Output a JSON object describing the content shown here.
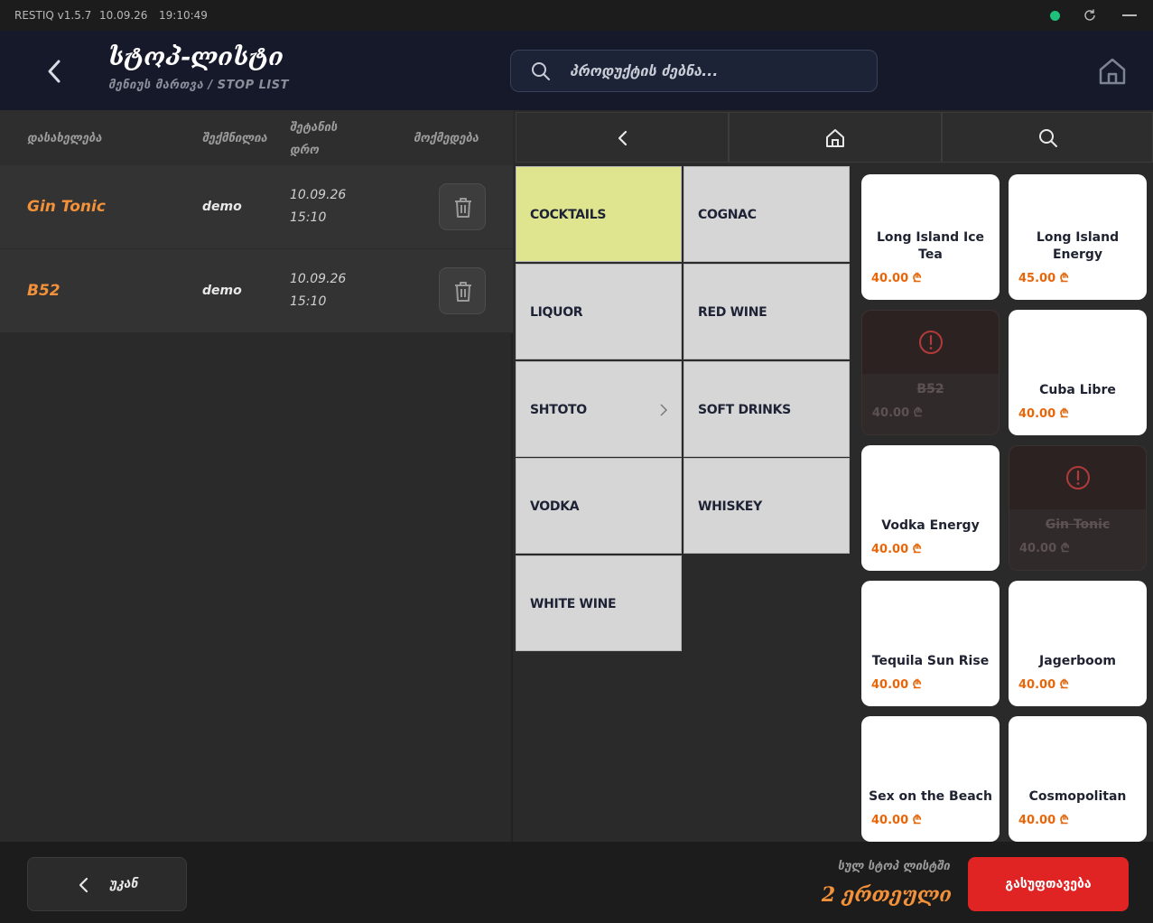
{
  "sysbar": {
    "app": "RESTIQ v1.5.7",
    "date": "10.09.26",
    "time": "19:10:49"
  },
  "header": {
    "title": "სტოპ-ლისტი",
    "subtitle": "მენიუს მართვა / STOP LIST",
    "search_placeholder": "პროდუქტის ძებნა..."
  },
  "table": {
    "headers": {
      "name": "დასახელება",
      "creator": "შექმნილია",
      "time_l1": "შეტანის",
      "time_l2": "დრო",
      "action": "მოქმედება"
    },
    "rows": [
      {
        "name": "Gin Tonic",
        "creator": "demo",
        "date": "10.09.26",
        "time": "15:10"
      },
      {
        "name": "B52",
        "creator": "demo",
        "date": "10.09.26",
        "time": "15:10"
      }
    ]
  },
  "categories": [
    {
      "label": "COCKTAILS",
      "active": true
    },
    {
      "label": "COGNAC"
    },
    {
      "label": "LIQUOR"
    },
    {
      "label": "RED WINE"
    },
    {
      "label": "SHTOTO",
      "has_children": true
    },
    {
      "label": "SOFT DRINKS"
    },
    {
      "label": "VODKA"
    },
    {
      "label": "WHISKEY"
    },
    {
      "label": "WHITE WINE"
    }
  ],
  "products": [
    {
      "name": "Long Island Ice Tea",
      "price": "40.00 ₾"
    },
    {
      "name": "Long Island Energy",
      "price": "45.00 ₾"
    },
    {
      "name": "B52",
      "price": "40.00 ₾",
      "stopped": true
    },
    {
      "name": "Cuba Libre",
      "price": "40.00 ₾"
    },
    {
      "name": "Vodka Energy",
      "price": "40.00 ₾"
    },
    {
      "name": "Gin Tonic",
      "price": "40.00 ₾",
      "stopped": true
    },
    {
      "name": "Tequila Sun Rise",
      "price": "40.00 ₾"
    },
    {
      "name": "Jagerboom",
      "price": "40.00 ₾"
    },
    {
      "name": "Sex on the Beach",
      "price": "40.00 ₾"
    },
    {
      "name": "Cosmopolitan",
      "price": "40.00 ₾"
    }
  ],
  "footer": {
    "back_label": "უკან",
    "total_label": "სულ სტოპ ლისტში",
    "total_value": "2 ერთეული",
    "clear_label": "გასუფთავება"
  },
  "colors": {
    "accent": "#f2913a",
    "danger": "#e02424",
    "active_category": "#dee58e",
    "header_bg": "#15192a"
  }
}
